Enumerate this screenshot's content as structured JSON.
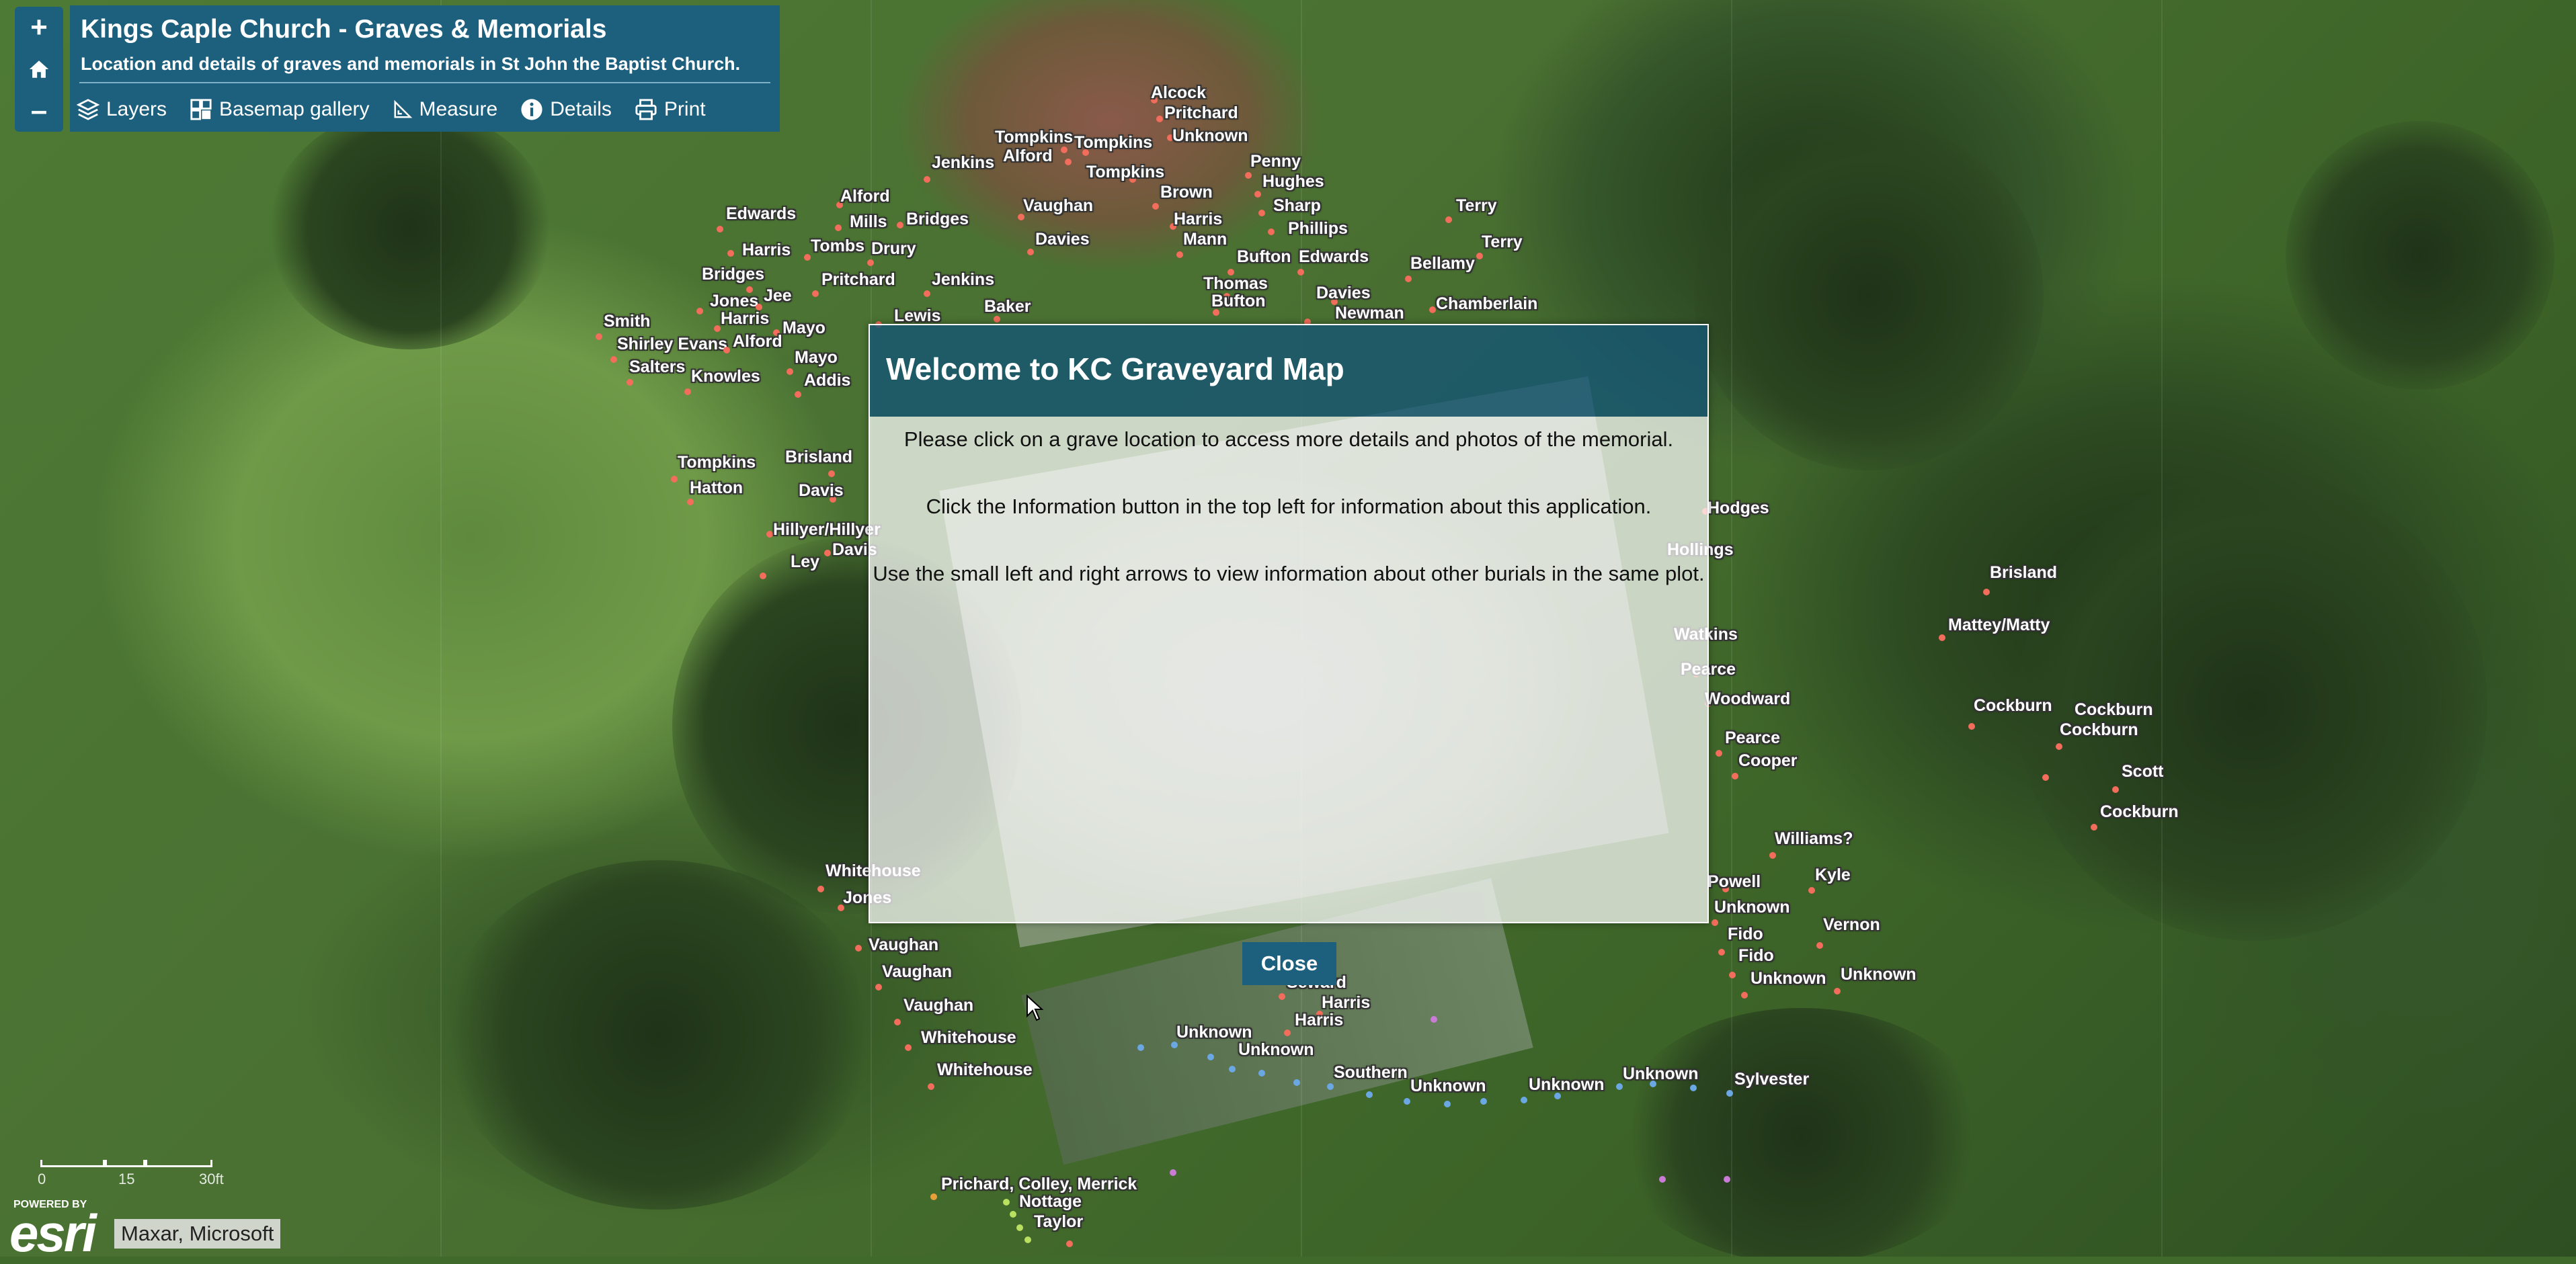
{
  "header": {
    "title": "Kings Caple Church - Graves & Memorials",
    "subtitle": "Location and details of graves and memorials in St John the Baptist Church."
  },
  "zoom": {
    "in_label": "+",
    "home_icon": "home-icon",
    "out_label": "–"
  },
  "toolbar": {
    "layers": "Layers",
    "basemap": "Basemap gallery",
    "measure": "Measure",
    "details": "Details",
    "print": "Print"
  },
  "modal": {
    "title": "Welcome to KC Graveyard Map",
    "line1": "Please click on a grave location to access more details and photos of the memorial.",
    "line2": "Click the Information button in the top left for information about this application.",
    "line3": "Use the small left and right arrows to view information about other burials in the same plot.",
    "close": "Close"
  },
  "scalebar": {
    "zero": "0",
    "mid": "15",
    "end": "30ft"
  },
  "attribution": {
    "powered": "POWERED BY",
    "logo": "esri",
    "text": "Maxar, Microsoft"
  },
  "colors": {
    "panel": "#1d607e",
    "grave_red": "#f26d5b",
    "grave_blue": "#6aa7e3",
    "grave_purple": "#c97bd6",
    "grave_green": "#b9e060"
  },
  "graves": [
    {
      "name": "Alcock"
    },
    {
      "name": "Pritchard"
    },
    {
      "name": "Unknown"
    },
    {
      "name": "Tompkins"
    },
    {
      "name": "Alford"
    },
    {
      "name": "Tompkins"
    },
    {
      "name": "Jenkins"
    },
    {
      "name": "Tompkins"
    },
    {
      "name": "Penny"
    },
    {
      "name": "Hughes"
    },
    {
      "name": "Brown"
    },
    {
      "name": "Alford"
    },
    {
      "name": "Vaughan"
    },
    {
      "name": "Sharp"
    },
    {
      "name": "Terry"
    },
    {
      "name": "Edwards"
    },
    {
      "name": "Mills"
    },
    {
      "name": "Bridges"
    },
    {
      "name": "Harris"
    },
    {
      "name": "Phillips"
    },
    {
      "name": "Davies"
    },
    {
      "name": "Mann"
    },
    {
      "name": "Terry"
    },
    {
      "name": "Harris"
    },
    {
      "name": "Tombs"
    },
    {
      "name": "Drury"
    },
    {
      "name": "Bufton"
    },
    {
      "name": "Edwards"
    },
    {
      "name": "Bellamy"
    },
    {
      "name": "Bridges"
    },
    {
      "name": "Pritchard"
    },
    {
      "name": "Jenkins"
    },
    {
      "name": "Thomas"
    },
    {
      "name": "Davies"
    },
    {
      "name": "Jones"
    },
    {
      "name": "Jee"
    },
    {
      "name": "Bufton"
    },
    {
      "name": "Chamberlain"
    },
    {
      "name": "Harris"
    },
    {
      "name": "Baker"
    },
    {
      "name": "Newman"
    },
    {
      "name": "Lewis"
    },
    {
      "name": "Smith"
    },
    {
      "name": "Mayo"
    },
    {
      "name": "Shirley Evans"
    },
    {
      "name": "Alford"
    },
    {
      "name": "Mayo"
    },
    {
      "name": "Salters"
    },
    {
      "name": "Knowles"
    },
    {
      "name": "Addis"
    },
    {
      "name": "Tompkins"
    },
    {
      "name": "Brisland"
    },
    {
      "name": "Hatton"
    },
    {
      "name": "Davis"
    },
    {
      "name": "Hillyer/Hillyer"
    },
    {
      "name": "Davis"
    },
    {
      "name": "Ley"
    },
    {
      "name": "Hodges"
    },
    {
      "name": "Hollings"
    },
    {
      "name": "Brisland"
    },
    {
      "name": "Mattey/Matty"
    },
    {
      "name": "Watkins"
    },
    {
      "name": "Pearce"
    },
    {
      "name": "Woodward"
    },
    {
      "name": "Cockburn"
    },
    {
      "name": "Cockburn"
    },
    {
      "name": "Cockburn"
    },
    {
      "name": "Pearce"
    },
    {
      "name": "Cooper"
    },
    {
      "name": "Scott"
    },
    {
      "name": "Cockburn"
    },
    {
      "name": "Williams?"
    },
    {
      "name": "Kyle"
    },
    {
      "name": "Powell"
    },
    {
      "name": "Unknown"
    },
    {
      "name": "Vernon"
    },
    {
      "name": "Fido"
    },
    {
      "name": "Fido"
    },
    {
      "name": "Unknown"
    },
    {
      "name": "Unknown"
    },
    {
      "name": "Whitehouse"
    },
    {
      "name": "Jones"
    },
    {
      "name": "Vaughan"
    },
    {
      "name": "Vaughan"
    },
    {
      "name": "Vaughan"
    },
    {
      "name": "Whitehouse"
    },
    {
      "name": "Whitehouse"
    },
    {
      "name": "Seward"
    },
    {
      "name": "Harris"
    },
    {
      "name": "Harris"
    },
    {
      "name": "Unknown"
    },
    {
      "name": "Unknown"
    },
    {
      "name": "Southern"
    },
    {
      "name": "Unknown"
    },
    {
      "name": "Unknown"
    },
    {
      "name": "Unknown"
    },
    {
      "name": "Sylvester"
    },
    {
      "name": "Prichard, Colley, Merrick"
    },
    {
      "name": "Nottage"
    },
    {
      "name": "Taylor"
    }
  ]
}
